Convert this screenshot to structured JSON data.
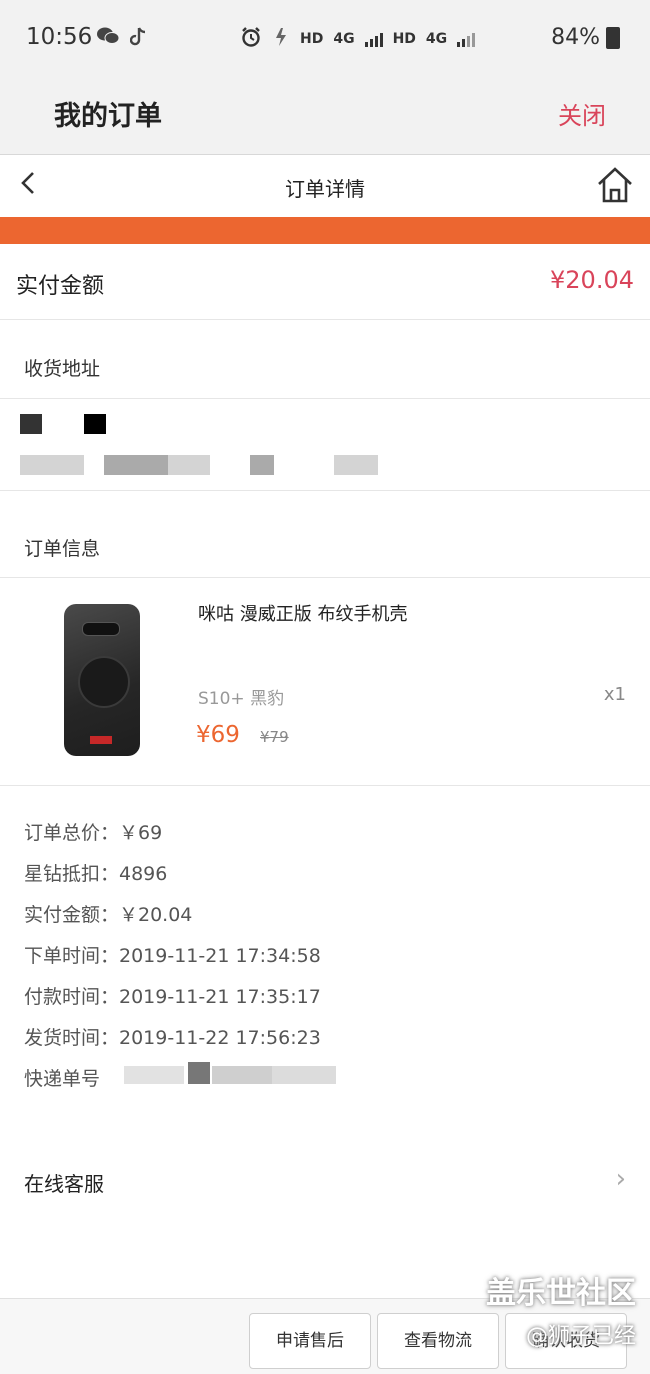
{
  "status_bar": {
    "time": "10:56",
    "network_hd1": "HD",
    "network_4g1": "4G",
    "network_hd2": "HD",
    "network_4g2": "4G",
    "battery": "84%"
  },
  "app_bar": {
    "title": "我的订单",
    "close_label": "关闭"
  },
  "nav": {
    "back": "<",
    "title": "订单详情"
  },
  "paid": {
    "label": "实付金额",
    "amount": "¥20.04"
  },
  "address_section": {
    "title": "收货地址"
  },
  "order_info_section": {
    "title": "订单信息"
  },
  "product": {
    "name": "咪咕 漫威正版 布纹手机壳",
    "spec": "S10+ 黑豹",
    "quantity": "x1",
    "price": "¥69",
    "original_price": "¥79",
    "case_brand": "MARVEL"
  },
  "details": [
    "订单总价：￥69",
    "星钻抵扣：4896",
    "实付金额：￥20.04",
    "下单时间：2019-11-21 17:34:58",
    "付款时间：2019-11-21 17:35:17",
    "发货时间：2019-11-22 17:56:23",
    "快递单号"
  ],
  "service": {
    "label": "在线客服",
    "chevron": "›"
  },
  "bottom_buttons": {
    "after_sale": "申请售后",
    "logistics": "查看物流",
    "confirm": "确认收货"
  },
  "watermark": {
    "line1": "盖乐世社区",
    "line2": "@狮子已经"
  },
  "colors": {
    "accent_orange": "#ec6630",
    "price_red": "#d9445a",
    "header_bg": "#f2f2f2"
  }
}
